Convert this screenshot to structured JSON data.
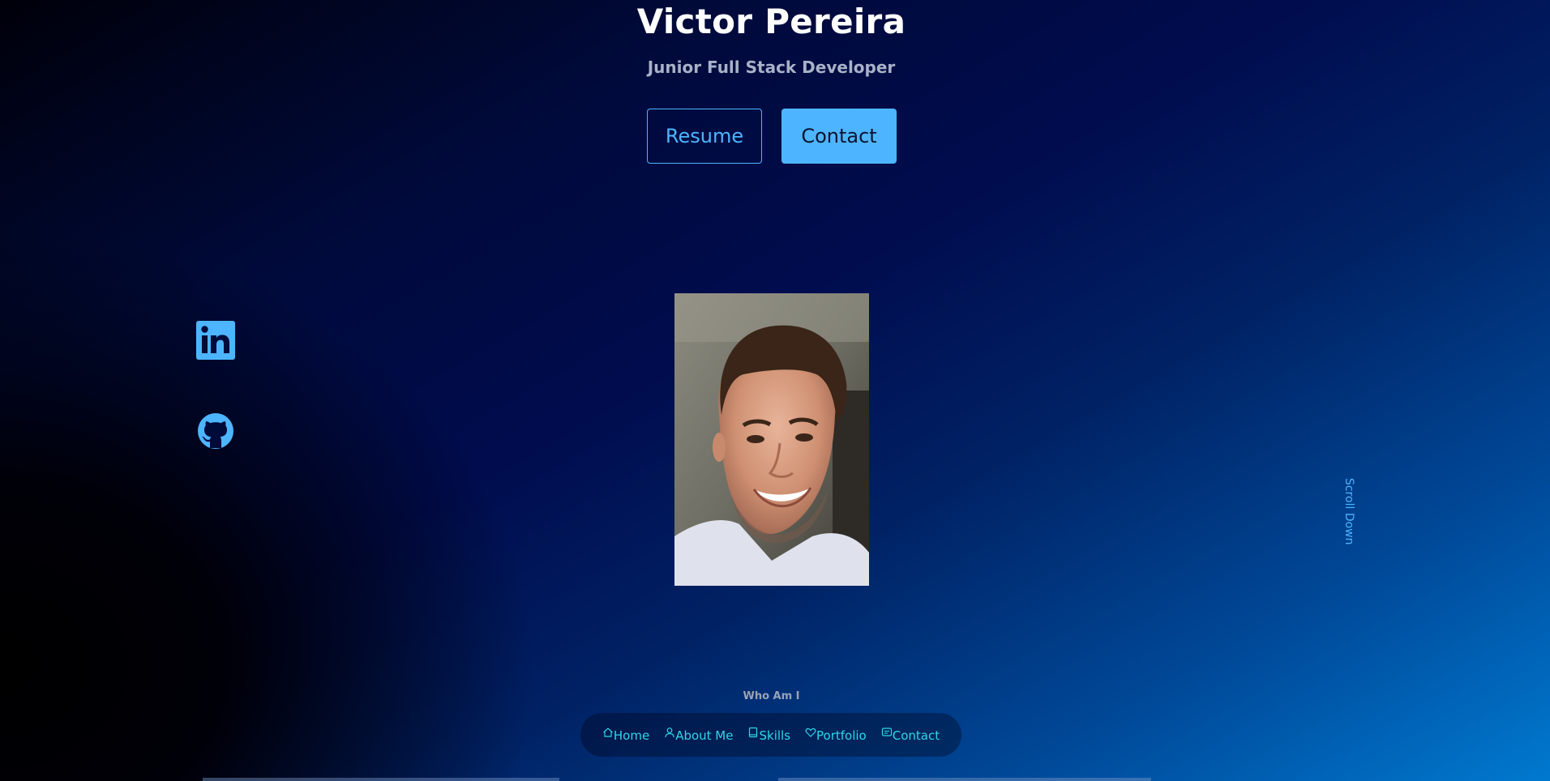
{
  "header": {
    "name": "Victor Pereira",
    "role": "Junior Full Stack Developer"
  },
  "buttons": {
    "resume_label": "Resume",
    "contact_label": "Contact"
  },
  "socials": [
    {
      "name": "LinkedIn",
      "icon": "linkedin-icon"
    },
    {
      "name": "GitHub",
      "icon": "github-icon"
    }
  ],
  "scroll_label": "Scroll Down",
  "section_label": "Who Am I",
  "nav": {
    "items": [
      {
        "label": "Home",
        "icon": "home-icon"
      },
      {
        "label": "About Me",
        "icon": "user-icon"
      },
      {
        "label": "Skills",
        "icon": "book-icon"
      },
      {
        "label": "Portfolio",
        "icon": "heart-icon"
      },
      {
        "label": "Contact",
        "icon": "message-icon"
      }
    ]
  },
  "colors": {
    "accent": "#4db5ff",
    "nav_text": "#2fd6e8",
    "background_dark": "#000000",
    "background_light": "#0079cf"
  }
}
